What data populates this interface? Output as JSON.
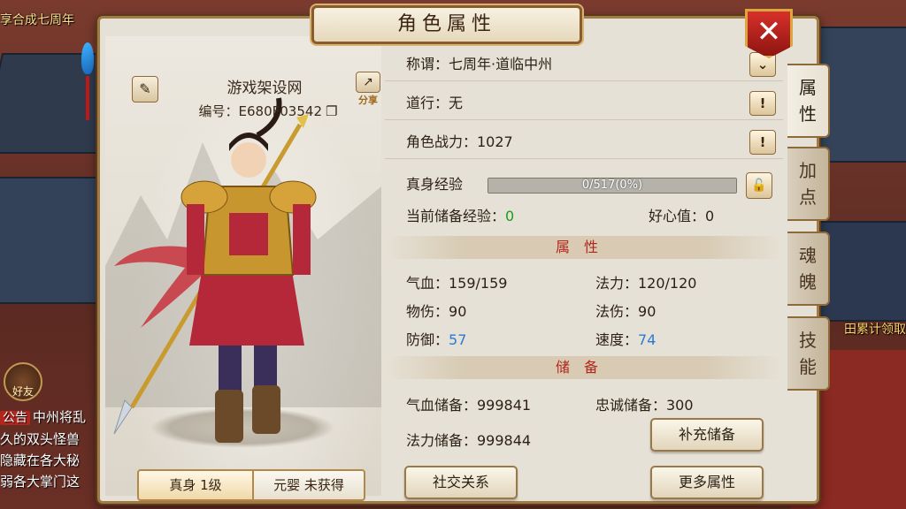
{
  "background": {
    "top_banner": "享合成七周年",
    "right_banner": "田累计领取",
    "friend_button": "好友",
    "chat": {
      "tag": "公告",
      "lines": [
        "中州将乱",
        "久的双头怪兽",
        "隐藏在各大秘",
        "弱各大掌门这"
      ]
    }
  },
  "window": {
    "title": "角色属性",
    "close_icon": "close-icon"
  },
  "character": {
    "name": "游戏架设网",
    "id_label": "编号：E680F03542",
    "share_label": "分享",
    "tabs": [
      {
        "label": "真身 1级",
        "active": true
      },
      {
        "label": "元婴 未获得",
        "active": false
      }
    ]
  },
  "info": {
    "title_row": "称谓：七周年·道临中州",
    "daoxing_row": "道行：无",
    "power_row": "角色战力：1027",
    "exp_label": "真身经验",
    "exp_text": "0/517(0%)",
    "exp_fraction": 0,
    "stored_exp_label": "当前储备经验：",
    "stored_exp_value": "0",
    "kindness_label": "好心值：0"
  },
  "attributes": {
    "heading": "属性",
    "hp": "气血：159/159",
    "mp": "法力：120/120",
    "phys_atk_label": "物伤：",
    "phys_atk": "90",
    "mag_atk_label": "法伤：",
    "mag_atk": "90",
    "defense_label": "防御：",
    "defense": "57",
    "speed_label": "速度：",
    "speed": "74"
  },
  "reserve": {
    "heading": "储备",
    "hp_reserve": "气血储备：999841",
    "loyalty_reserve": "忠诚储备：300",
    "mp_reserve": "法力储备：999844",
    "replenish_button": "补充储备"
  },
  "buttons": {
    "social": "社交关系",
    "more_attributes": "更多属性"
  },
  "side_tabs": [
    {
      "label": "属性",
      "active": true
    },
    {
      "label": "加点",
      "active": false
    },
    {
      "label": "魂魄",
      "active": false
    },
    {
      "label": "技能",
      "active": false
    }
  ],
  "colors": {
    "accent_red": "#b3261e",
    "value_blue": "#2b79d6",
    "value_green": "#1a9b1a",
    "exp_bar_fill": "#e4b43a"
  }
}
